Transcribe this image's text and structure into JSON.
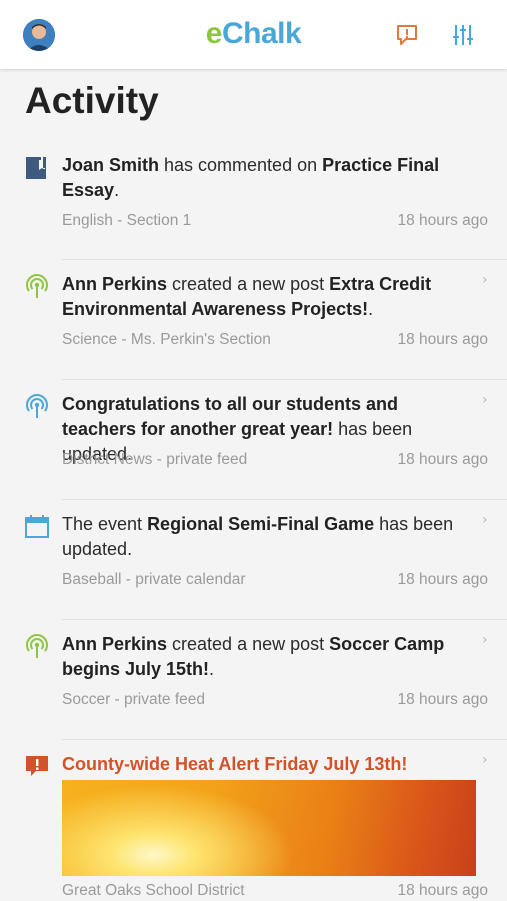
{
  "header": {
    "logo_e": "e",
    "logo_rest": "Chalk",
    "avatar_icon": "user-avatar",
    "alert_icon": "alert-speech-icon",
    "filter_icon": "sliders-filter-icon",
    "colors": {
      "logo_green": "#8cc63f",
      "logo_blue": "#4aa8d8",
      "alert_orange": "#e07a3c",
      "filter_blue": "#4aa8d8"
    }
  },
  "page": {
    "title": "Activity"
  },
  "feed": [
    {
      "icon": "document-icon",
      "parts": [
        {
          "t": "Joan Smith",
          "b": true
        },
        {
          "t": " has commented on ",
          "b": false
        },
        {
          "t": "Practice Final Essay",
          "b": true
        },
        {
          "t": ".",
          "b": false
        }
      ],
      "source": "English - Section 1",
      "time": "18 hours ago",
      "chevron": false
    },
    {
      "icon": "broadcast-icon",
      "parts": [
        {
          "t": "Ann Perkins",
          "b": true
        },
        {
          "t": " created a new post ",
          "b": false
        },
        {
          "t": "Extra Credit Environmental Awareness Projects!",
          "b": true
        },
        {
          "t": ".",
          "b": false
        }
      ],
      "source": "Science - Ms. Perkin's Section",
      "time": "18 hours ago",
      "chevron": true
    },
    {
      "icon": "broadcast-icon",
      "parts": [
        {
          "t": "Congratulations to all our students and teachers for another great year!",
          "b": true
        },
        {
          "t": " has been updated.",
          "b": false
        }
      ],
      "source": "District News - private feed",
      "time": "18 hours ago",
      "chevron": true
    },
    {
      "icon": "calendar-icon",
      "parts": [
        {
          "t": "The event ",
          "b": false
        },
        {
          "t": "Regional Semi-Final Game",
          "b": true
        },
        {
          "t": " has been updated.",
          "b": false
        }
      ],
      "source": "Baseball - private calendar",
      "time": "18 hours ago",
      "chevron": true
    },
    {
      "icon": "broadcast-icon",
      "parts": [
        {
          "t": "Ann Perkins",
          "b": true
        },
        {
          "t": " created a new post ",
          "b": false
        },
        {
          "t": "Soccer Camp begins July 15th!",
          "b": true
        },
        {
          "t": ".",
          "b": false
        }
      ],
      "source": "Soccer - private feed",
      "time": "18 hours ago",
      "chevron": true
    }
  ],
  "alert_item": {
    "icon": "alert-speech-icon",
    "title": "County-wide Heat Alert Friday July 13th!",
    "source": "Great Oaks School District",
    "time": "18 hours ago",
    "chevron": true
  },
  "chevron_glyph": "›"
}
